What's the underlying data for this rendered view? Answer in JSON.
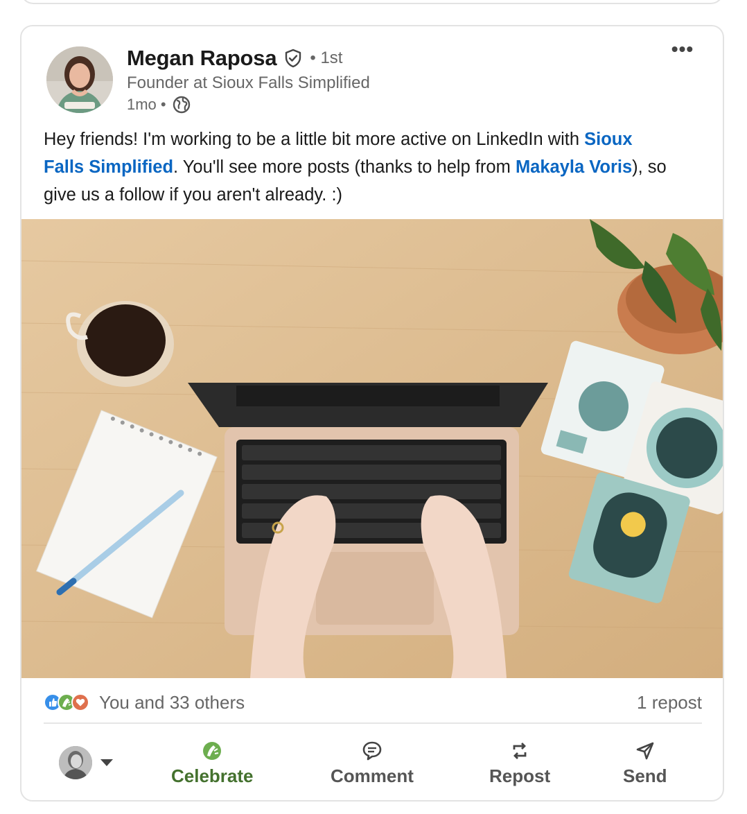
{
  "post": {
    "author": {
      "name": "Megan Raposa",
      "degree": "• 1st",
      "headline": "Founder at Sioux Falls Simplified",
      "time": "1mo •",
      "visibility_icon": "globe-icon",
      "verified_icon": "verified-shield-icon"
    },
    "more_label": "•••",
    "text": {
      "part1": "Hey friends! I'm working to be a little bit more active on LinkedIn with ",
      "link1": "Sioux Falls Simplified",
      "part2": ". You'll see more posts (thanks to help from ",
      "link2": "Makayla Voris",
      "part3": "), so give us a follow if you aren't already. :)"
    },
    "image_icon": "laptop-desk-photo",
    "social": {
      "reaction_icons": [
        "like-icon",
        "celebrate-icon",
        "love-icon"
      ],
      "reactions_text": "You and 33 others",
      "reposts_text": "1 repost"
    },
    "actions": {
      "celebrate": "Celebrate",
      "comment": "Comment",
      "repost": "Repost",
      "send": "Send"
    }
  },
  "colors": {
    "link": "#0a66c2",
    "celebrate": "#44712e",
    "like": "#378fe9",
    "love": "#df704d"
  }
}
